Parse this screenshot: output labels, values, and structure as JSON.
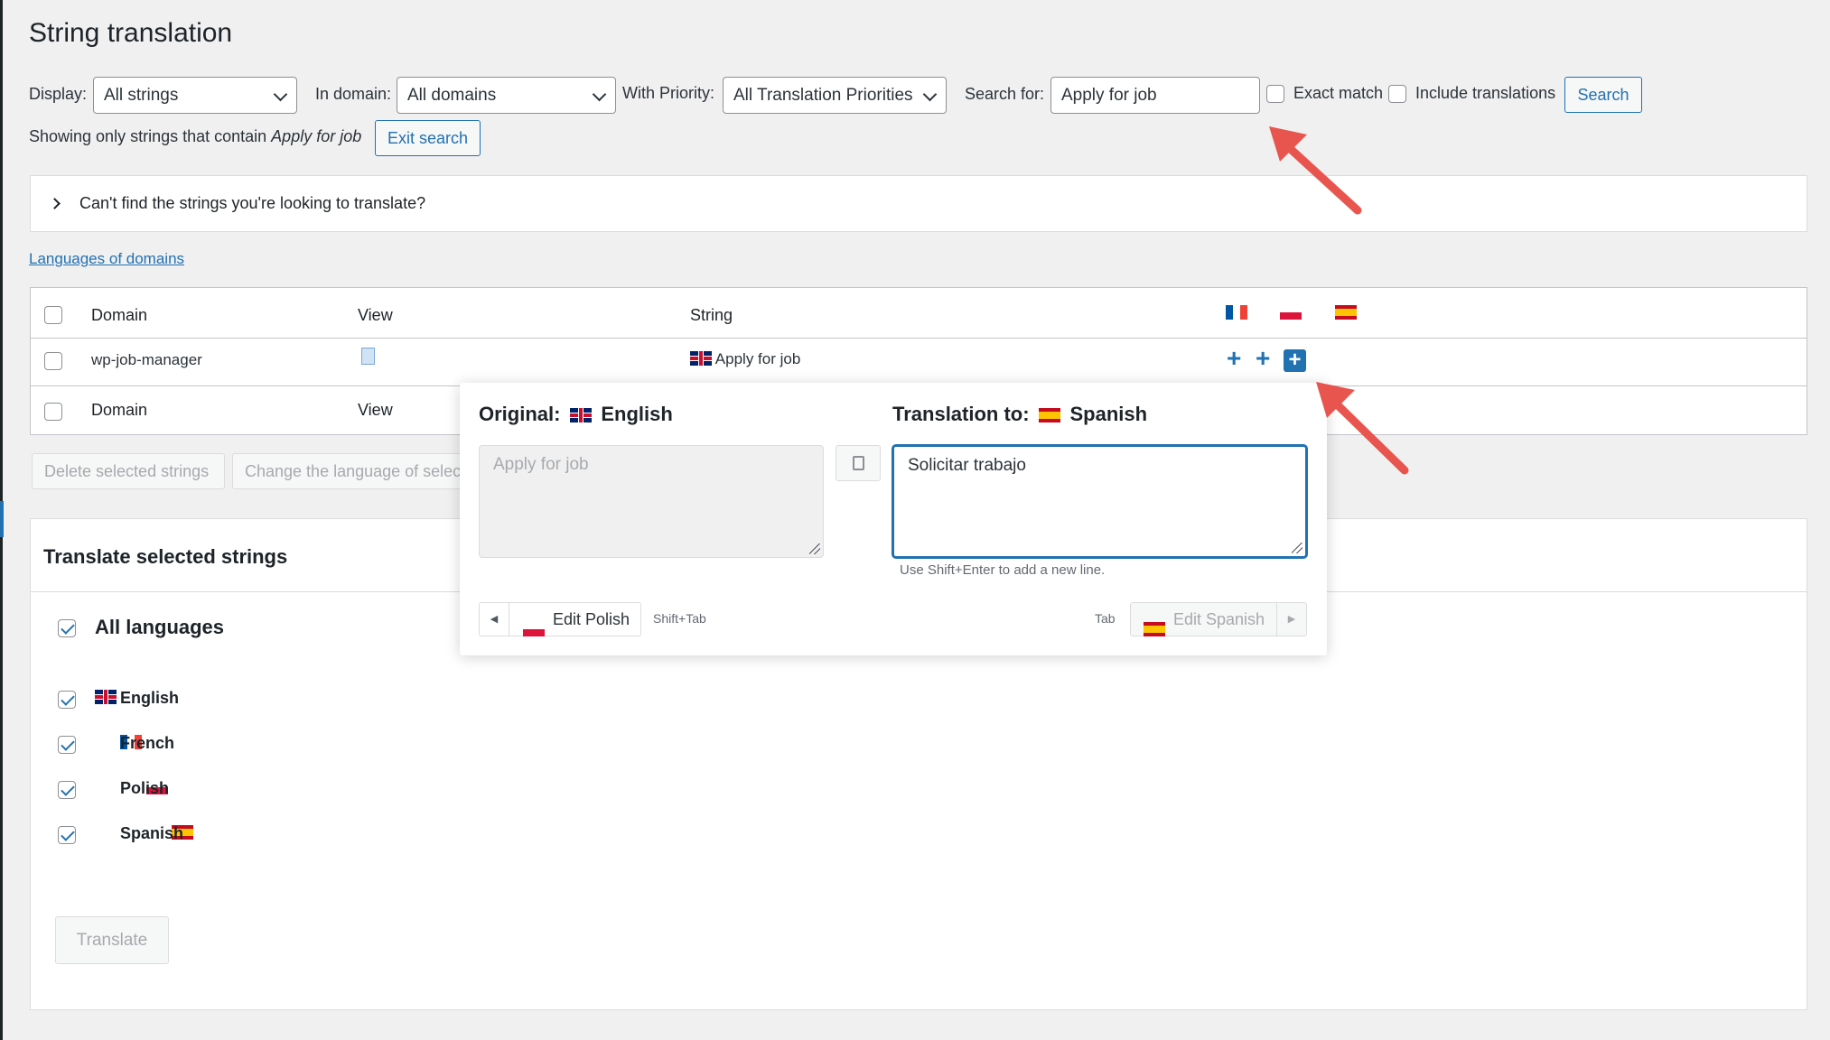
{
  "page": {
    "title": "String translation"
  },
  "filters": {
    "display_label": "Display:",
    "display_value": "All strings",
    "domain_label": "In domain:",
    "domain_value": "All domains",
    "priority_label": "With Priority:",
    "priority_value": "All Translation Priorities",
    "search_label": "Search for:",
    "search_value": "Apply for job",
    "exact_match_label": "Exact match",
    "include_translations_label": "Include translations",
    "search_button": "Search"
  },
  "search_info": {
    "prefix": "Showing only strings that contain",
    "term": "Apply for job",
    "exit_button": "Exit search"
  },
  "help_box": {
    "text": "Can't find the strings you're looking to translate?"
  },
  "languages_link": "Languages of domains",
  "table": {
    "headers": {
      "domain": "Domain",
      "view": "View",
      "string": "String"
    },
    "row": {
      "domain": "wp-job-manager",
      "string": "Apply for job"
    },
    "footer": {
      "domain": "Domain",
      "view": "View"
    }
  },
  "bulk": {
    "delete_button": "Delete selected strings",
    "change_language_button": "Change the language of selected strings"
  },
  "translate_panel": {
    "title": "Translate selected strings",
    "all_languages": "All languages",
    "languages": [
      "English",
      "French",
      "Polish",
      "Spanish"
    ],
    "translate_button": "Translate"
  },
  "popup": {
    "original_label": "Original:",
    "original_language": "English",
    "original_text": "Apply for job",
    "translation_label": "Translation to:",
    "translation_language": "Spanish",
    "translation_value": "Solicitar trabajo",
    "hint": "Use Shift+Enter to add a new line.",
    "prev_button": "Edit Polish",
    "prev_shortcut": "Shift+Tab",
    "next_shortcut": "Tab",
    "next_button": "Edit Spanish"
  },
  "icons": [
    "chevron-down-icon",
    "chevron-right-icon",
    "document-icon",
    "plus-icon",
    "copy-icon",
    "arrow-icon"
  ],
  "colors": {
    "accent": "#2271b1",
    "arrow": "#e8554e",
    "background": "#f0f0f1"
  }
}
